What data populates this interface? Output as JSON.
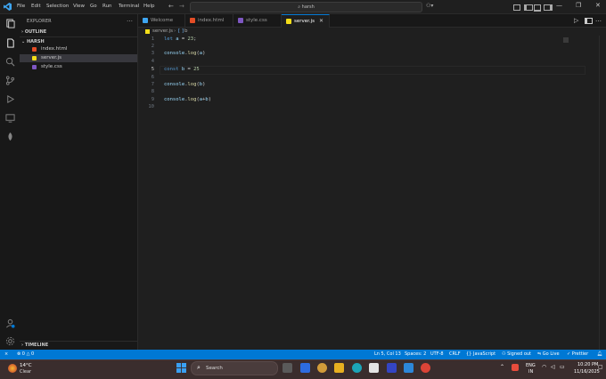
{
  "app": {
    "title_search": "harsh"
  },
  "menu": [
    "File",
    "Edit",
    "Selection",
    "View",
    "Go",
    "Run",
    "Terminal",
    "Help"
  ],
  "sidebar": {
    "header": "EXPLORER",
    "outline_label": "OUTLINE",
    "folder_label": "HARSH",
    "files": [
      {
        "name": "index.html",
        "type": "html"
      },
      {
        "name": "server.js",
        "type": "js",
        "selected": true
      },
      {
        "name": "style.css",
        "type": "css"
      }
    ],
    "timeline_label": "TIMELINE"
  },
  "tabs": [
    {
      "label": "Welcome",
      "active": false
    },
    {
      "label": "index.html",
      "active": false
    },
    {
      "label": "style.css",
      "active": false
    },
    {
      "label": "server.js",
      "active": true
    }
  ],
  "breadcrumb": {
    "file": "server.js",
    "symbol": "b"
  },
  "editor": {
    "lines": [
      {
        "n": "1",
        "text": "let a = 23;"
      },
      {
        "n": "2",
        "text": ""
      },
      {
        "n": "3",
        "text": "console.log(a)"
      },
      {
        "n": "4",
        "text": ""
      },
      {
        "n": "5",
        "text": "const b = 25"
      },
      {
        "n": "6",
        "text": ""
      },
      {
        "n": "7",
        "text": "console.log(b)"
      },
      {
        "n": "8",
        "text": ""
      },
      {
        "n": "9",
        "text": "console.log(a+b)"
      },
      {
        "n": "10",
        "text": ""
      }
    ]
  },
  "statusbar": {
    "errors": "0",
    "warnings": "0",
    "position": "Ln 5, Col 13",
    "spaces": "Spaces: 2",
    "encoding": "UTF-8",
    "eol": "CRLF",
    "language": "JavaScript",
    "account": "Signed out",
    "golive": "Go Live",
    "prettier": "Prettier"
  },
  "taskbar": {
    "weather_temp": "14°C",
    "weather_desc": "Clear",
    "search_label": "Search",
    "lang_top": "ENG",
    "lang_bottom": "IN",
    "time": "10:20 PM",
    "date": "11/16/2025"
  },
  "colors": {
    "accent": "#0078d4",
    "status": "#0078d4",
    "editor_bg": "#1f1f1f"
  }
}
